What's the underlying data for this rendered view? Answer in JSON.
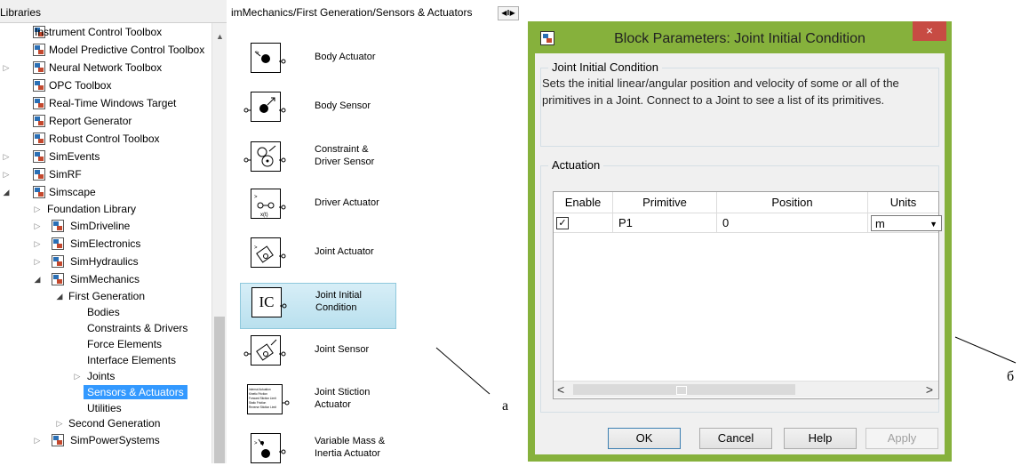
{
  "libraries": {
    "header": "Libraries",
    "items": [
      {
        "label": "Instrument Control Toolbox"
      },
      {
        "label": "Model Predictive Control Toolbox"
      },
      {
        "label": "Neural Network Toolbox"
      },
      {
        "label": "OPC Toolbox"
      },
      {
        "label": "Real-Time Windows Target"
      },
      {
        "label": "Report Generator"
      },
      {
        "label": "Robust Control Toolbox"
      },
      {
        "label": "SimEvents"
      },
      {
        "label": "SimRF"
      },
      {
        "label": "Simscape"
      },
      {
        "label": "Foundation Library"
      },
      {
        "label": "SimDriveline"
      },
      {
        "label": "SimElectronics"
      },
      {
        "label": "SimHydraulics"
      },
      {
        "label": "SimMechanics"
      },
      {
        "label": "First Generation"
      },
      {
        "label": "Bodies"
      },
      {
        "label": "Constraints & Drivers"
      },
      {
        "label": "Force Elements"
      },
      {
        "label": "Interface Elements"
      },
      {
        "label": "Joints"
      },
      {
        "label": "Sensors & Actuators"
      },
      {
        "label": "Utilities"
      },
      {
        "label": "Second Generation"
      },
      {
        "label": "SimPowerSystems"
      }
    ]
  },
  "blocks": {
    "path": "imMechanics/First Generation/Sensors & Actuators",
    "items": [
      {
        "label": "Body Actuator"
      },
      {
        "label": "Body Sensor"
      },
      {
        "label": "Constraint &\nDriver  Sensor"
      },
      {
        "label": "Driver Actuator"
      },
      {
        "label": "Joint Actuator"
      },
      {
        "label": "Joint Initial\nCondition",
        "symbol": "IC"
      },
      {
        "label": "Joint Sensor"
      },
      {
        "label": "Joint Stiction\nActuator"
      },
      {
        "label": "Variable Mass &\nInertia Actuator"
      }
    ]
  },
  "annotations": {
    "a": "а",
    "b": "б"
  },
  "dialog": {
    "title": "Block Parameters: Joint Initial Condition",
    "close": "×",
    "group1_title": "Joint Initial Condition",
    "description": "Sets the initial linear/angular position and velocity of some or all of the primitives in a Joint. Connect to a Joint to see a list of its primitives.",
    "group2_title": "Actuation",
    "table": {
      "headers": [
        "Enable",
        "Primitive",
        "Position",
        "Units"
      ],
      "row": {
        "enable": "✓",
        "primitive": "P1",
        "position": "0",
        "units": "m"
      }
    },
    "buttons": {
      "ok": "OK",
      "cancel": "Cancel",
      "help": "Help",
      "apply": "Apply"
    }
  },
  "colors": {
    "dialog_frame": "#86b13c",
    "close_button": "#c74b43",
    "selection": "#3399ff"
  }
}
